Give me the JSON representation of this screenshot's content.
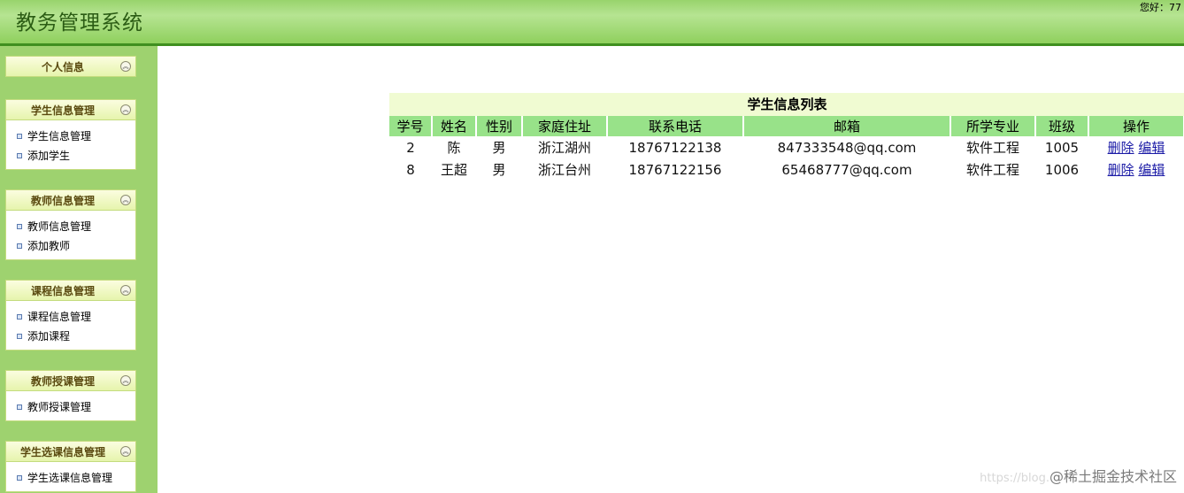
{
  "header": {
    "title": "教务管理系统",
    "greeting": "您好：77"
  },
  "sidebar": {
    "panels": [
      {
        "title": "个人信息",
        "items": []
      },
      {
        "title": "学生信息管理",
        "items": [
          "学生信息管理",
          "添加学生"
        ]
      },
      {
        "title": "教师信息管理",
        "items": [
          "教师信息管理",
          "添加教师"
        ]
      },
      {
        "title": "课程信息管理",
        "items": [
          "课程信息管理",
          "添加课程"
        ]
      },
      {
        "title": "教师授课管理",
        "items": [
          "教师授课管理"
        ]
      },
      {
        "title": "学生选课信息管理",
        "items": [
          "学生选课信息管理"
        ]
      }
    ],
    "toggle_glyph": "︽"
  },
  "table": {
    "caption": "学生信息列表",
    "columns": [
      "学号",
      "姓名",
      "性别",
      "家庭住址",
      "联系电话",
      "邮箱",
      "所学专业",
      "班级",
      "操作"
    ],
    "rows": [
      {
        "id": "2",
        "name": "陈",
        "gender": "男",
        "address": "浙江湖州",
        "phone": "18767122138",
        "email": "847333548@qq.com",
        "major": "软件工程",
        "class": "1005",
        "delete": "删除",
        "edit": "编辑"
      },
      {
        "id": "8",
        "name": "王超",
        "gender": "男",
        "address": "浙江台州",
        "phone": "18767122156",
        "email": "65468777@qq.com",
        "major": "软件工程",
        "class": "1006",
        "delete": "删除",
        "edit": "编辑"
      }
    ]
  },
  "watermark": {
    "url": "https://blog.",
    "text": "@稀土掘金技术社区"
  },
  "colors": {
    "header_bar": "#98d36c",
    "sidebar_bg": "#9ed26f",
    "table_header": "#98e289",
    "caption_bg": "#f0fbd2",
    "link": "#1a1aa6"
  }
}
